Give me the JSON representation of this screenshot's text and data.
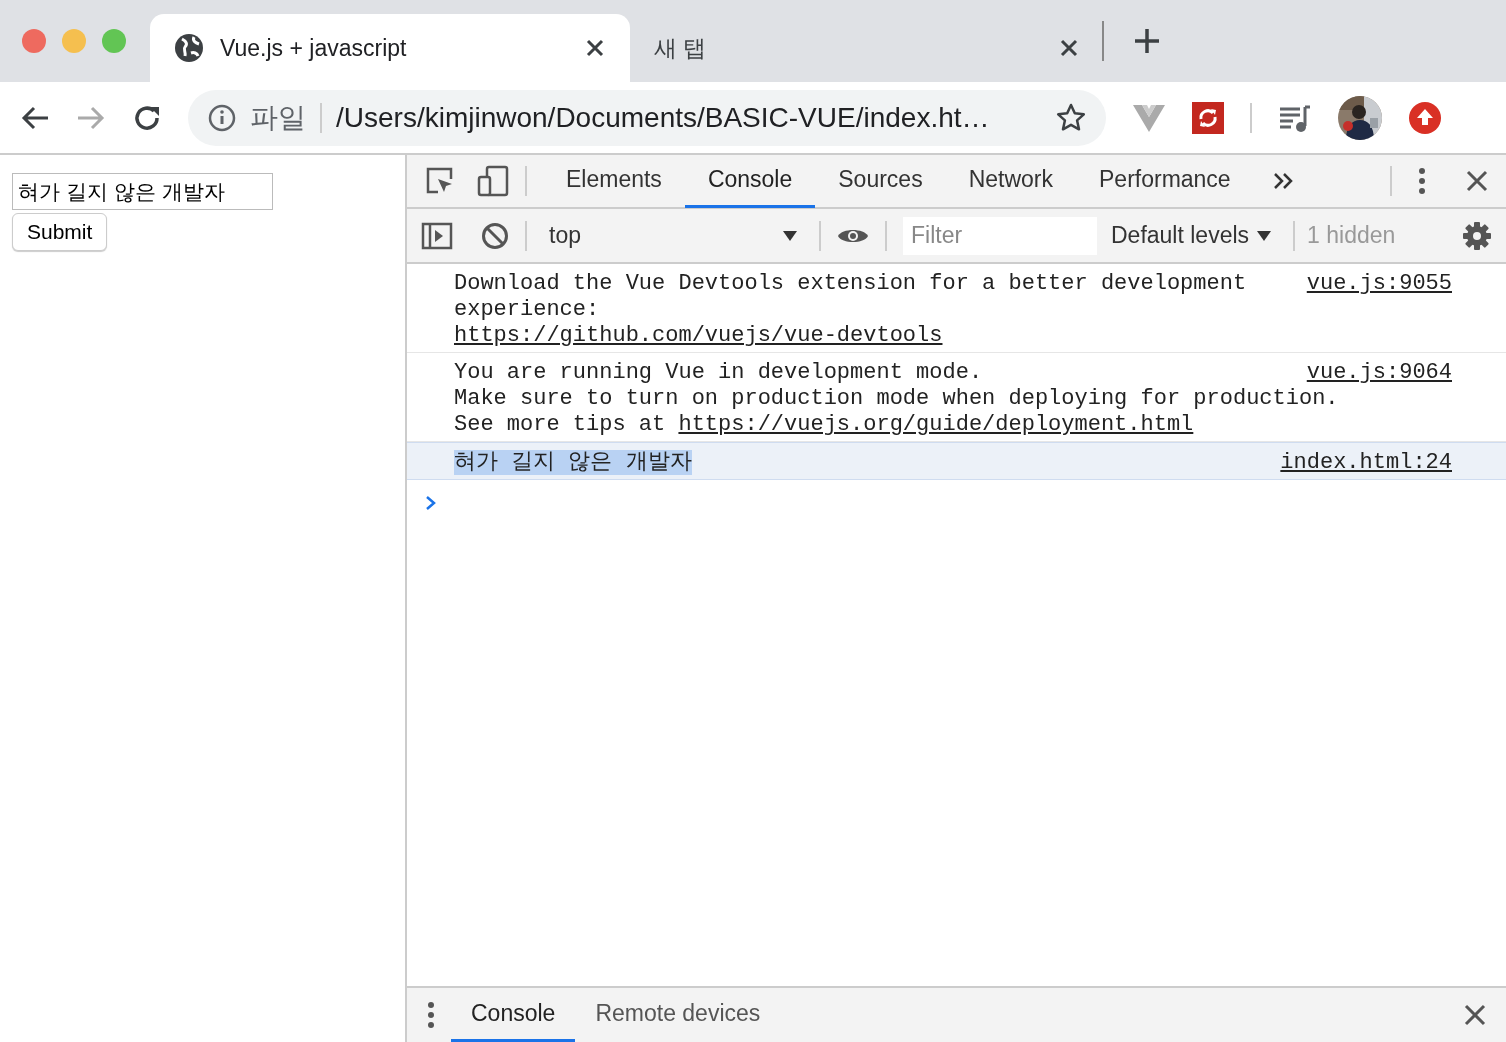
{
  "browser": {
    "tabs": [
      {
        "title": "Vue.js + javascript",
        "selected": true
      },
      {
        "title": "새 탭",
        "selected": false
      }
    ],
    "address": {
      "scheme": "파일",
      "url": "/Users/kimjinwon/Documents/BASIC-VUE/index.ht…"
    },
    "forward_disabled": true
  },
  "page": {
    "input_value": "혀가 길지 않은 개발자",
    "button": "Submit"
  },
  "devtools": {
    "tabs": [
      {
        "label": "Elements",
        "selected": false
      },
      {
        "label": "Console",
        "selected": true
      },
      {
        "label": "Sources",
        "selected": false
      },
      {
        "label": "Network",
        "selected": false
      },
      {
        "label": "Performance",
        "selected": false
      }
    ],
    "context": "top",
    "filter_placeholder": "Filter",
    "levels": "Default levels",
    "hidden": "1 hidden",
    "messages": [
      {
        "lines": [
          [
            {
              "text": "Download the Vue Devtools extension for a better development",
              "link": false
            }
          ],
          [
            {
              "text": "experience:",
              "link": false
            }
          ],
          [
            {
              "text": "https://github.com/vuejs/vue-devtools",
              "link": true
            }
          ]
        ],
        "source": "vue.js:9055",
        "highlighted": false
      },
      {
        "lines": [
          [
            {
              "text": "You are running Vue in development mode.",
              "link": false
            }
          ],
          [
            {
              "text": "Make sure to turn on production mode when deploying for production.",
              "link": false
            }
          ],
          [
            {
              "text": "See more tips at ",
              "link": false
            },
            {
              "text": "https://vuejs.org/guide/deployment.html",
              "link": true
            }
          ]
        ],
        "source": "vue.js:9064",
        "highlighted": false
      },
      {
        "lines": [
          [
            {
              "text": "혀가 길지 않은 개발자",
              "link": false
            }
          ]
        ],
        "source": "index.html:24",
        "highlighted": true
      }
    ],
    "drawer_tabs": [
      {
        "label": "Console",
        "selected": true
      },
      {
        "label": "Remote devices",
        "selected": false
      }
    ]
  }
}
